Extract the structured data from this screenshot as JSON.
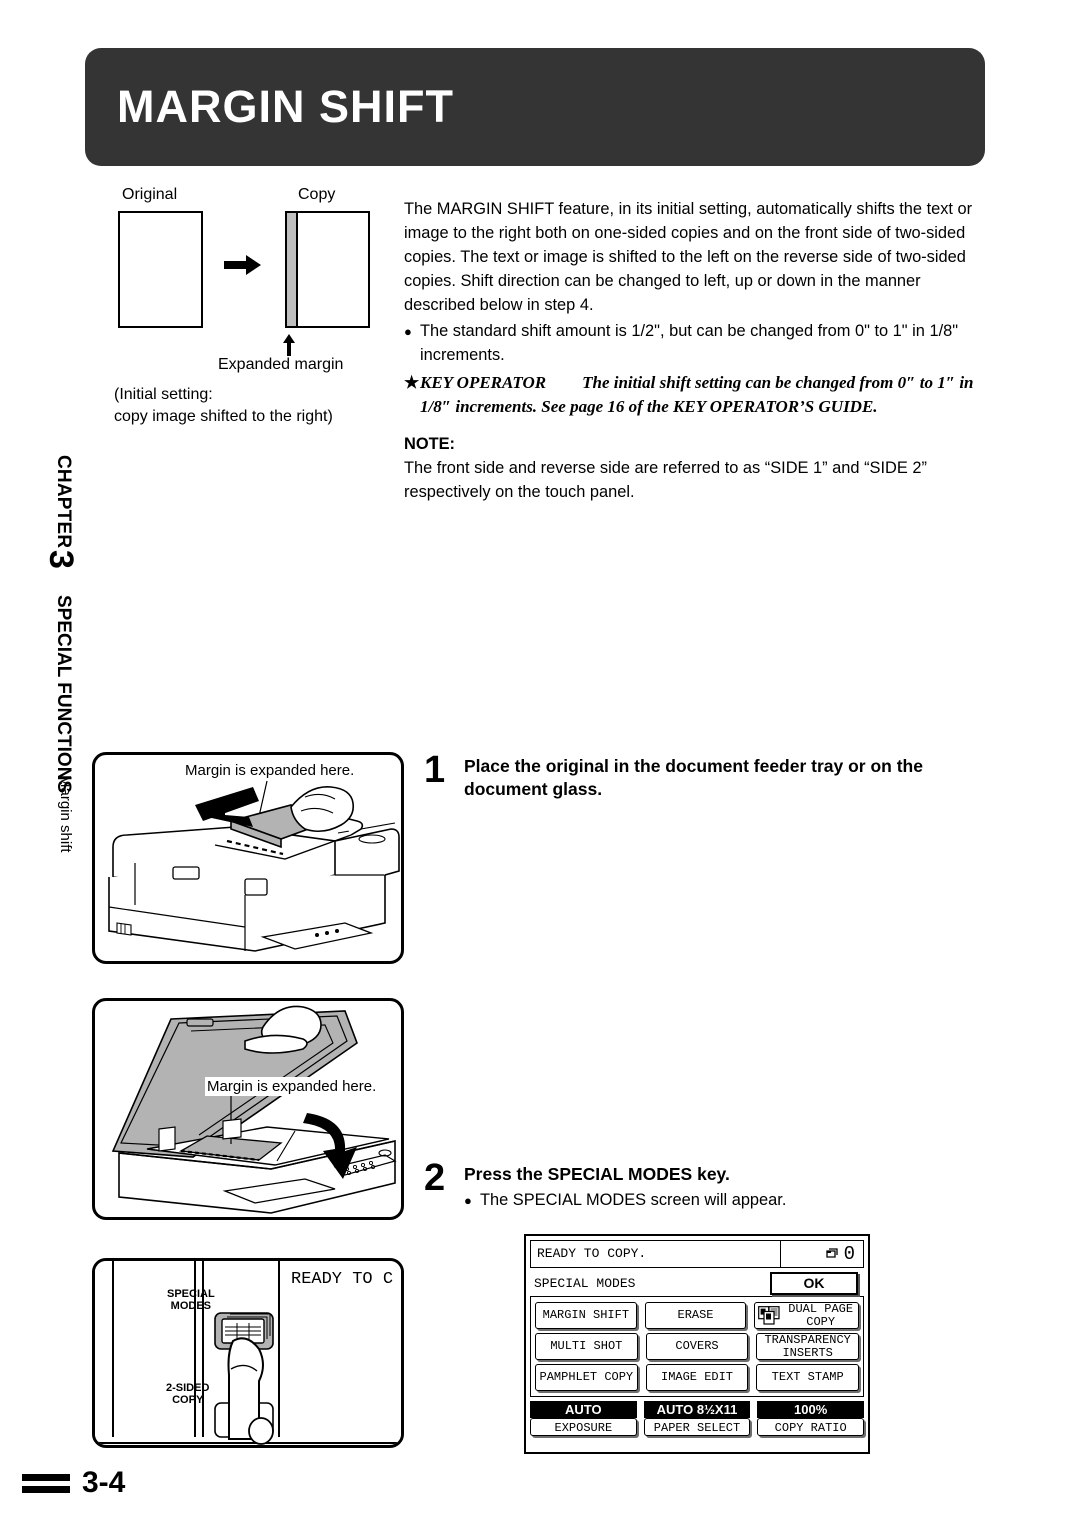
{
  "header": {
    "title": "MARGIN SHIFT"
  },
  "chapter_tab": {
    "word": "CHAPTER",
    "number": "3",
    "section": "SPECIAL FUNCTIONS",
    "sub": "Margin shift"
  },
  "diagram": {
    "original_label": "Original",
    "copy_label": "Copy",
    "expanded_margin_label": "Expanded margin",
    "initial_setting_line1": "(Initial setting:",
    "initial_setting_line2": "copy image shifted to the right)"
  },
  "intro": {
    "paragraph": "The MARGIN SHIFT feature, in its initial setting, automatically shifts the text or image to the right both on one-sided copies and on the front side of two-sided copies. The text or image is shifted to the left on the reverse side of two-sided copies. Shift direction can be changed to left, up or down in the manner described below in step 4.",
    "bullet_mark": "●",
    "bullet_text": "The standard shift amount is 1/2\", but can be changed from 0\" to 1\" in 1/8\" increments.",
    "star_mark": "★",
    "key_operator_label": "KEY OPERATOR",
    "key_operator_text": "The initial shift setting can be changed from 0″ to 1″ in 1/8″ increments.  See page 16 of the KEY OPERATOR’S GUIDE.",
    "note_heading": "NOTE:",
    "note_text": "The front side and reverse side are referred to as “SIDE 1” and “SIDE 2” respectively on the touch panel."
  },
  "illustrations": {
    "feeder_callout": "Margin is expanded here.",
    "glass_callout": "Margin is expanded here.",
    "panel_special_modes_line1": "SPECIAL",
    "panel_special_modes_line2": "MODES",
    "panel_two_sided_line1": "2-SIDED",
    "panel_two_sided_line2": "COPY",
    "panel_display_text": "READY TO C"
  },
  "steps": [
    {
      "number": "1",
      "title": "Place the original in the document feeder tray or on the document glass.",
      "bullet_mark": "",
      "bullet": ""
    },
    {
      "number": "2",
      "title": "Press the SPECIAL MODES key.",
      "bullet_mark": "●",
      "bullet": "The SPECIAL MODES screen will appear."
    }
  ],
  "touch_panel": {
    "status_text": "READY TO COPY.",
    "counter_icon": "copy-stack-icon",
    "counter_value": "0",
    "modes_label": "SPECIAL MODES",
    "ok_label": "OK",
    "button_rows": [
      [
        {
          "label": "MARGIN SHIFT",
          "icon": ""
        },
        {
          "label": "ERASE",
          "icon": ""
        },
        {
          "label": "DUAL PAGE\nCOPY",
          "icon": "dual-page-icon"
        }
      ],
      [
        {
          "label": "MULTI SHOT",
          "icon": ""
        },
        {
          "label": "COVERS",
          "icon": ""
        },
        {
          "label": "TRANSPARENCY\nINSERTS",
          "icon": ""
        }
      ],
      [
        {
          "label": "PAMPHLET COPY",
          "icon": ""
        },
        {
          "label": "IMAGE EDIT",
          "icon": ""
        },
        {
          "label": "TEXT STAMP",
          "icon": ""
        }
      ]
    ],
    "status_bar": [
      {
        "value": "AUTO",
        "label": "EXPOSURE"
      },
      {
        "value": "AUTO 8½X11",
        "label": "PAPER SELECT"
      },
      {
        "value": "100%",
        "label": "COPY RATIO"
      }
    ]
  },
  "footer": {
    "page": "3-4"
  },
  "colors": {
    "header_bg": "#343434",
    "margin_band": "#bfbfbf",
    "illustration_shade": "#b3b3b3"
  }
}
